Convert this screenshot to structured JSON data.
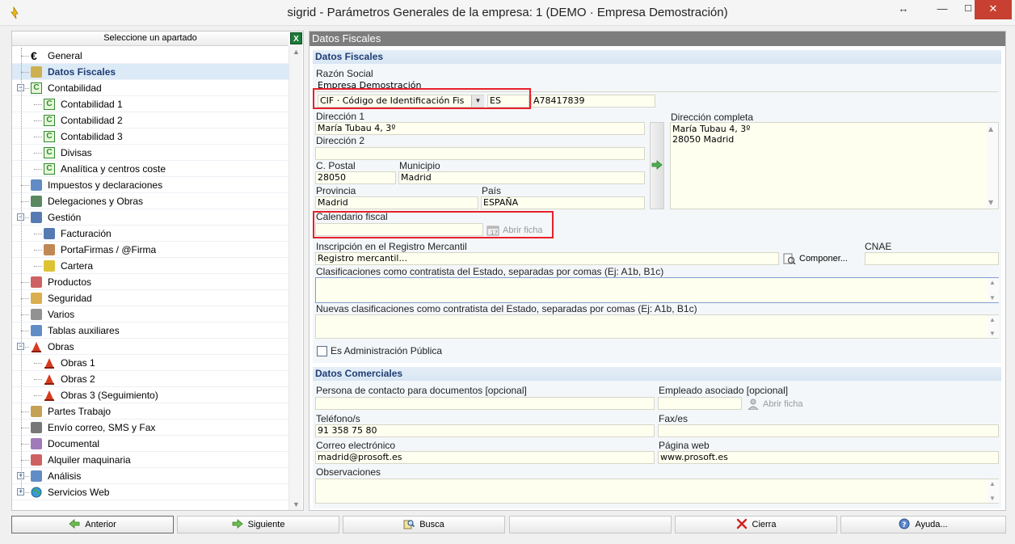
{
  "window": {
    "title": "sigrid - Parámetros Generales de la empresa: 1 (DEMO · Empresa Demostración)",
    "resize_glyph": "↔",
    "minimize_glyph": "—",
    "maximize_glyph": "☐",
    "close_glyph": "✕"
  },
  "sidebar": {
    "header": "Seleccione un apartado",
    "excel_icon_text": "X",
    "items": [
      {
        "label": "General",
        "icon": "euro-icon",
        "level": 0,
        "expander": ""
      },
      {
        "label": "Datos Fiscales",
        "icon": "fiscal-data-icon",
        "level": 0,
        "expander": "",
        "selected": true
      },
      {
        "label": "Contabilidad",
        "icon": "accounting-icon",
        "level": 0,
        "expander": "−"
      },
      {
        "label": "Contabilidad 1",
        "icon": "accounting-icon",
        "level": 1,
        "expander": ""
      },
      {
        "label": "Contabilidad 2",
        "icon": "accounting-icon",
        "level": 1,
        "expander": ""
      },
      {
        "label": "Contabilidad 3",
        "icon": "accounting-icon",
        "level": 1,
        "expander": ""
      },
      {
        "label": "Divisas",
        "icon": "accounting-icon",
        "level": 1,
        "expander": ""
      },
      {
        "label": "Analítica y centros coste",
        "icon": "accounting-icon",
        "level": 1,
        "expander": ""
      },
      {
        "label": "Impuestos y declaraciones",
        "icon": "book-icon",
        "level": 0,
        "expander": ""
      },
      {
        "label": "Delegaciones y Obras",
        "icon": "people-icon",
        "level": 0,
        "expander": ""
      },
      {
        "label": "Gestión",
        "icon": "management-icon",
        "level": 0,
        "expander": "−"
      },
      {
        "label": "Facturación",
        "icon": "invoice-icon",
        "level": 1,
        "expander": ""
      },
      {
        "label": "PortaFirmas / @Firma",
        "icon": "signature-icon",
        "level": 1,
        "expander": ""
      },
      {
        "label": "Cartera",
        "icon": "portfolio-icon",
        "level": 1,
        "expander": ""
      },
      {
        "label": "Productos",
        "icon": "product-icon",
        "level": 0,
        "expander": ""
      },
      {
        "label": "Seguridad",
        "icon": "lock-icon",
        "level": 0,
        "expander": ""
      },
      {
        "label": "Varios",
        "icon": "tools-icon",
        "level": 0,
        "expander": ""
      },
      {
        "label": "Tablas auxiliares",
        "icon": "table-icon",
        "level": 0,
        "expander": ""
      },
      {
        "label": "Obras",
        "icon": "traffic-cone-icon",
        "level": 0,
        "expander": "−"
      },
      {
        "label": "Obras 1",
        "icon": "traffic-cone-icon",
        "level": 1,
        "expander": ""
      },
      {
        "label": "Obras 2",
        "icon": "traffic-cone-icon",
        "level": 1,
        "expander": ""
      },
      {
        "label": "Obras 3 (Seguimiento)",
        "icon": "traffic-cone-icon",
        "level": 1,
        "expander": ""
      },
      {
        "label": "Partes Trabajo",
        "icon": "clipboard-icon",
        "level": 0,
        "expander": ""
      },
      {
        "label": "Envío correo, SMS y Fax",
        "icon": "envelope-icon",
        "level": 0,
        "expander": ""
      },
      {
        "label": "Documental",
        "icon": "document-icon",
        "level": 0,
        "expander": ""
      },
      {
        "label": "Alquiler maquinaria",
        "icon": "machinery-icon",
        "level": 0,
        "expander": ""
      },
      {
        "label": "Análisis",
        "icon": "spreadsheet-icon",
        "level": 0,
        "expander": "+"
      },
      {
        "label": "Servicios Web",
        "icon": "globe-icon",
        "level": 0,
        "expander": "+"
      }
    ]
  },
  "main": {
    "panel_title": "Datos Fiscales",
    "fiscal": {
      "section_title": "Datos Fiscales",
      "razon_social_label": "Razón Social",
      "razon_social_value": "Empresa Demostración",
      "id_type_value": "CIF · Código de Identificación Fis",
      "country_code_value": "ES",
      "cif_value": "A78417839",
      "direccion1_label": "Dirección 1",
      "direccion1_value": "María Tubau 4, 3º",
      "direccion2_label": "Dirección 2",
      "direccion2_value": "",
      "direccion_completa_label": "Dirección completa",
      "direccion_completa_line1": "María Tubau 4, 3º",
      "direccion_completa_line2": "28050 Madrid",
      "cpostal_label": "C. Postal",
      "cpostal_value": "28050",
      "municipio_label": "Municipio",
      "municipio_value": "Madrid",
      "provincia_label": "Provincia",
      "provincia_value": "Madrid",
      "pais_label": "País",
      "pais_value": "ESPAÑA",
      "calendario_label": "Calendario fiscal",
      "calendario_value": "",
      "abrir_ficha_label": "Abrir ficha",
      "registro_label": "Inscripción en el Registro Mercantil",
      "registro_value": "Registro mercantil...",
      "componer_label": "Componer...",
      "cnae_label": "CNAE",
      "cnae_value": "",
      "clasificaciones_label": "Clasificaciones como contratista del Estado, separadas por comas (Ej: A1b, B1c)",
      "clasificaciones_value": "",
      "nuevas_clasificaciones_label": "Nuevas clasificaciones como contratista del Estado, separadas por comas (Ej: A1b, B1c)",
      "nuevas_clasificaciones_value": "",
      "admin_publica_label": "Es Administración Pública",
      "admin_publica_checked": false
    },
    "comercial": {
      "section_title": "Datos Comerciales",
      "persona_contacto_label": "Persona de contacto para documentos [opcional]",
      "persona_contacto_value": "",
      "empleado_label": "Empleado asociado [opcional]",
      "empleado_value": "",
      "abrir_ficha_label": "Abrir ficha",
      "telefono_label": "Teléfono/s",
      "telefono_value": "91 358 75 80",
      "fax_label": "Fax/es",
      "fax_value": "",
      "correo_label": "Correo electrónico",
      "correo_value": "madrid@prosoft.es",
      "web_label": "Página web",
      "web_value": "www.prosoft.es",
      "observaciones_label": "Observaciones",
      "observaciones_value": ""
    }
  },
  "footer": {
    "anterior": "Anterior",
    "siguiente": "Siguiente",
    "busca": "Busca",
    "empty": "",
    "cierra": "Cierra",
    "ayuda": "Ayuda..."
  },
  "colors": {
    "highlight_box": "#e8202a",
    "section_header": "#1f3d74",
    "panel_title_bg": "#7d7d7d",
    "close_button": "#c84031"
  }
}
